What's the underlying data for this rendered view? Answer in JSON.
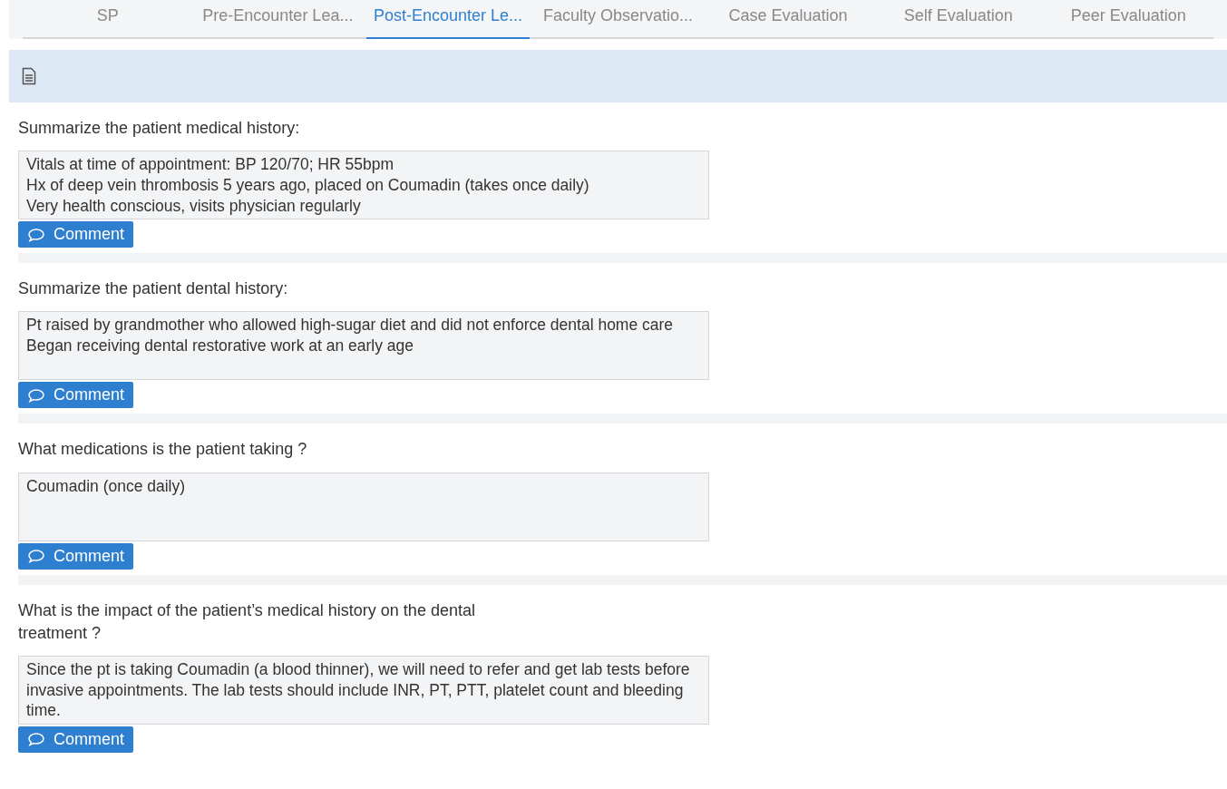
{
  "tabs": [
    {
      "label": "SP",
      "selected": false
    },
    {
      "label": "Pre-Encounter Lea...",
      "selected": false
    },
    {
      "label": "Post-Encounter Le...",
      "selected": true
    },
    {
      "label": "Faculty Observatio...",
      "selected": false
    },
    {
      "label": "Case Evaluation",
      "selected": false
    },
    {
      "label": "Self Evaluation",
      "selected": false
    },
    {
      "label": "Peer Evaluation",
      "selected": false
    }
  ],
  "questions": [
    {
      "label": "Summarize the patient medical history:",
      "answer": "Vitals at time of appointment: BP 120/70; HR 55bpm\nHx of deep vein thrombosis 5 years ago, placed on Coumadin (takes once daily)\nVery health conscious, visits physician regularly",
      "button": "Comment"
    },
    {
      "label": "Summarize the patient dental history:",
      "answer": "Pt raised by grandmother who allowed high-sugar diet and did not enforce dental home care\nBegan receiving dental restorative work at an early age",
      "button": "Comment"
    },
    {
      "label": "What medications is the patient taking ?",
      "answer": "Coumadin (once daily)",
      "button": "Comment"
    },
    {
      "label": "What is the impact of the patient’s medical history on the dental treatment ?",
      "answer": "Since the pt is taking Coumadin (a blood thinner), we will need to refer and get lab tests before invasive appointments. The lab tests should include INR, PT, PTT, platelet count and bleeding time.",
      "button": "Comment"
    }
  ]
}
